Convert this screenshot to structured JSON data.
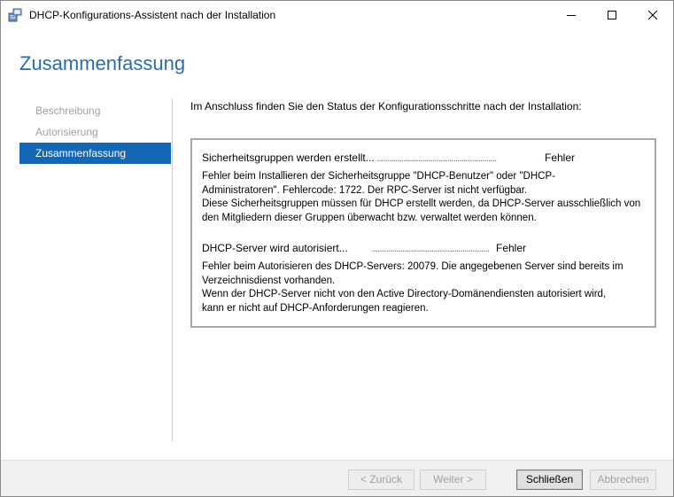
{
  "window": {
    "title": "DHCP-Konfigurations-Assistent nach der Installation",
    "app_icon": "dhcp-server-icon",
    "controls": [
      "minimize-icon",
      "maximize-icon",
      "close-icon"
    ]
  },
  "header": {
    "title": "Zusammenfassung"
  },
  "nav": {
    "items": [
      {
        "label": "Beschreibung",
        "state": "inactive"
      },
      {
        "label": "Autorisierung",
        "state": "inactive"
      },
      {
        "label": "Zusammenfassung",
        "state": "active"
      }
    ]
  },
  "main": {
    "intro": "Im Anschluss finden Sie den Status der Konfigurationsschritte nach der Installation:",
    "results": [
      {
        "step": "Sicherheitsgruppen werden erstellt...",
        "dots": "..........................................................",
        "status": "Fehler",
        "message_lines": [
          "Fehler beim Installieren der Sicherheitsgruppe \"DHCP-Benutzer\" oder \"DHCP-",
          "Administratoren\". Fehlercode: 1722. Der RPC-Server ist nicht verfügbar.",
          "Diese Sicherheitsgruppen müssen für DHCP erstellt werden, da DHCP-Server ausschließlich von",
          "den Mitgliedern dieser Gruppen überwacht bzw. verwaltet werden können."
        ]
      },
      {
        "step": "DHCP-Server wird autorisiert...",
        "dots": "..........................................................",
        "status": "Fehler",
        "message_lines": [
          "Fehler beim Autorisieren des DHCP-Servers: 20079. Die angegebenen Server sind bereits im",
          "Verzeichnisdienst vorhanden.",
          "Wenn der DHCP-Server nicht von den Active Directory-Domänendiensten autorisiert wird,",
          "kann er nicht auf DHCP-Anforderungen reagieren."
        ]
      }
    ]
  },
  "footer": {
    "back_label": "< Zurück",
    "next_label": "Weiter >",
    "close_label": "Schließen",
    "cancel_label": "Abbrechen"
  },
  "colors": {
    "title_blue": "#2e6da4",
    "nav_active_bg": "#1467b4",
    "nav_inactive_text": "#a0a0a0"
  }
}
